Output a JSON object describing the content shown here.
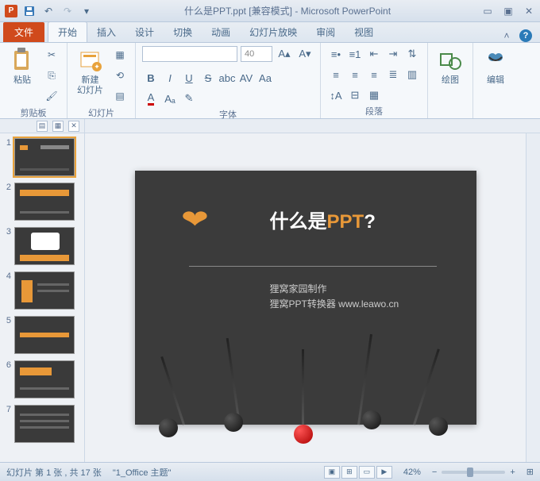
{
  "titlebar": {
    "filename": "什么是PPT.ppt [兼容模式]",
    "app": "Microsoft PowerPoint",
    "app_letter": "P"
  },
  "tabs": {
    "file": "文件",
    "items": [
      "开始",
      "插入",
      "设计",
      "切换",
      "动画",
      "幻灯片放映",
      "审阅",
      "视图"
    ],
    "active_index": 0
  },
  "ribbon": {
    "clipboard": {
      "label": "剪贴板",
      "paste": "粘贴"
    },
    "slides": {
      "label": "幻灯片",
      "new_slide": "新建\n幻灯片"
    },
    "font": {
      "label": "字体",
      "name_placeholder": "",
      "size_value": "40"
    },
    "paragraph": {
      "label": "段落"
    },
    "drawing": {
      "label": "绘图"
    },
    "editing": {
      "label": "编辑"
    }
  },
  "thumbnails": {
    "count": 7,
    "selected": 1
  },
  "slide": {
    "title_prefix": "什么是",
    "title_accent": "PPT",
    "title_suffix": "?",
    "subtitle_line1": "狸窝家园制作",
    "subtitle_line2": "狸窝PPT转换器  www.leawo.cn"
  },
  "statusbar": {
    "slide_info": "幻灯片 第 1 张 , 共 17 张",
    "theme": "\"1_Office 主题\"",
    "lang": "",
    "zoom": "42%",
    "fit": "⊞"
  }
}
